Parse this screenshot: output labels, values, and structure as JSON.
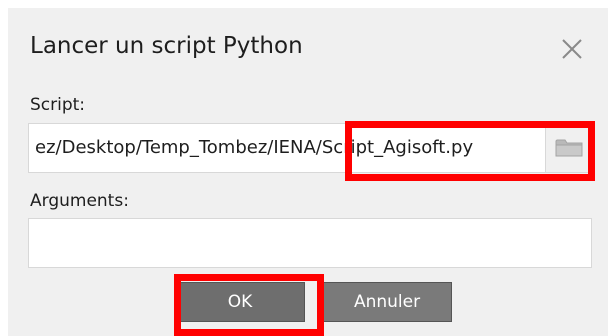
{
  "dialog": {
    "title": "Lancer un script Python",
    "close_icon": "close-icon"
  },
  "script_field": {
    "label": "Script:",
    "value": "ez/Desktop/Temp_Tombez/IENA/Script_Agisoft.py",
    "browse_icon": "folder-icon"
  },
  "arguments_field": {
    "label": "Arguments:",
    "value": ""
  },
  "buttons": {
    "ok_label": "OK",
    "cancel_label": "Annuler"
  },
  "annotations": {
    "highlight_color": "#ff0000"
  }
}
